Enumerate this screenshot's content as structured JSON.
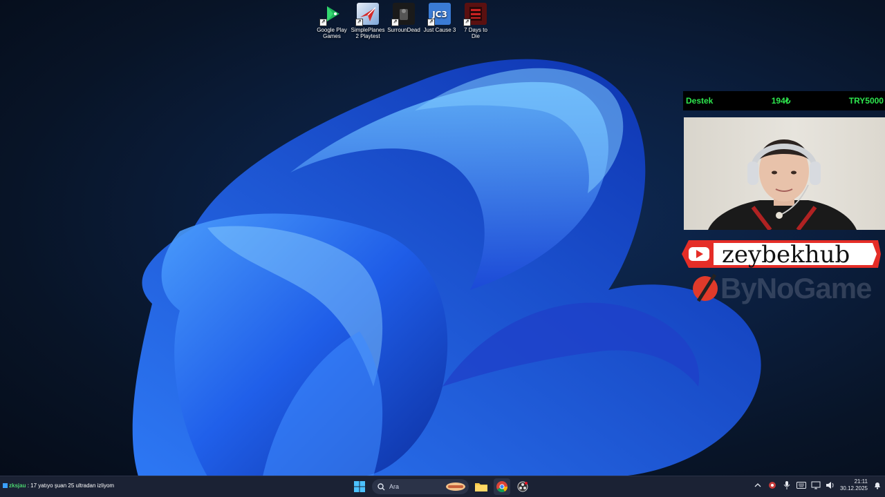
{
  "desktop": {
    "icons": [
      {
        "label": "Google Play Games",
        "name": "google-play-games"
      },
      {
        "label": "SimplePlanes 2 Playtest",
        "name": "simpleplanes-2-playtest"
      },
      {
        "label": "SurrounDead",
        "name": "surroundead"
      },
      {
        "label": "Just Cause 3",
        "name": "just-cause-3"
      },
      {
        "label": "7 Days to Die",
        "name": "7-days-to-die"
      }
    ]
  },
  "overlay": {
    "donation": {
      "label": "Destek",
      "current": "194₺",
      "goal": "TRY5000"
    },
    "channel": "zeybekhub",
    "sponsor": "ByNoGame"
  },
  "taskbar": {
    "ticker_user": "zksjau",
    "ticker_message": " : 17 yatıyo şuan 25 ultradan izliyom",
    "search_placeholder": "Ara",
    "time": "21:11",
    "date": "30.12.2025"
  },
  "colors": {
    "accent_green": "#2ee84f",
    "youtube_red": "#e52d27",
    "taskbar_bg": "#1b2234"
  }
}
